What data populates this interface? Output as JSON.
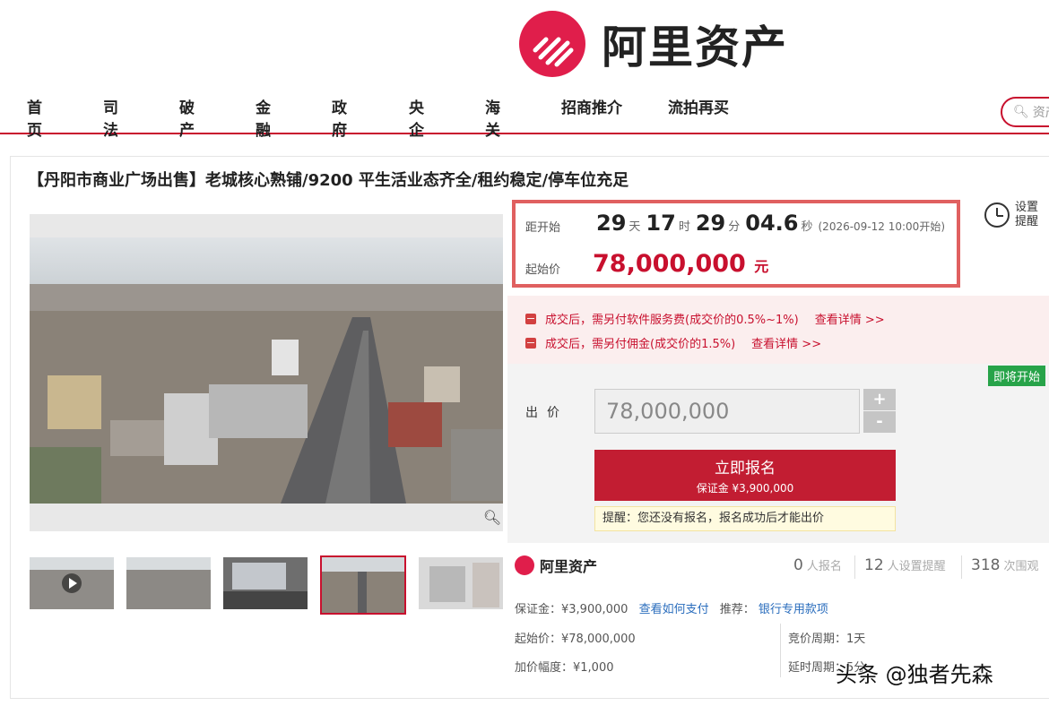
{
  "brand": {
    "name": "阿里资产",
    "color": "#e01e4b"
  },
  "nav": [
    {
      "label": "首页"
    },
    {
      "label": "司法"
    },
    {
      "label": "破产"
    },
    {
      "label": "金融"
    },
    {
      "label": "政府"
    },
    {
      "label": "央企"
    },
    {
      "label": "海关"
    },
    {
      "label": "招商推介"
    },
    {
      "label": "流拍再买"
    }
  ],
  "search": {
    "placeholder": "资产"
  },
  "item": {
    "title": "【丹阳市商业广场出售】老城核心熟铺/9200 平生活业态齐全/租约稳定/停车位充足"
  },
  "countdown": {
    "label": "距开始",
    "days": "29",
    "days_unit": "天",
    "hours": "17",
    "hours_unit": "时",
    "minutes": "29",
    "minutes_unit": "分",
    "seconds": "04.6",
    "seconds_unit": "秒",
    "start_time": "(2026-09-12 10:00开始)"
  },
  "start_price": {
    "label": "起始价",
    "value": "78,000,000",
    "unit": "元"
  },
  "remind": {
    "label": "设置提醒"
  },
  "fees": [
    {
      "text": "成交后，需另付软件服务费(成交价的0.5%~1%)",
      "link": "查看详情 >>"
    },
    {
      "text": "成交后，需另付佣金(成交价的1.5%)",
      "link": "查看详情 >>"
    }
  ],
  "status_badge": "即将开始",
  "bid": {
    "label": "出价",
    "value": "78,000,000",
    "plus": "+",
    "minus": "-",
    "apply_label": "立即报名",
    "deposit_label": "保证金 ¥3,900,000",
    "tip": "提醒：您还没有报名，报名成功后才能出价"
  },
  "stats": {
    "signups": "0",
    "signups_label": "人报名",
    "reminders": "12",
    "reminders_label": "人设置提醒",
    "views": "318",
    "views_label": "次围观"
  },
  "details": {
    "deposit": "保证金：¥3,900,000",
    "how_pay": "查看如何支付",
    "recommend": "推荐：",
    "bank_link": "银行专用款项",
    "start_price": "起始价：¥78,000,000",
    "increment": "加价幅度：¥1,000",
    "cycle": "竞价周期：1天",
    "delay": "延时周期：5分"
  },
  "watermark": "头条 @独者先森"
}
